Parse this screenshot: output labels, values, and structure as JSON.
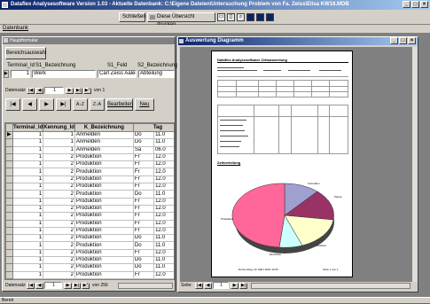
{
  "window": {
    "title": "Dataflex Analysesoftware Version 1.03 - Aktuelle Datenbank: C:\\Eigene Dateien\\Untersuchung Problem von Fa. Zeiss\\Elisa KW18.MDB"
  },
  "toolbar": {
    "close_label": "Schließen",
    "print_label": "Diese Übersicht drucken"
  },
  "menu": {
    "datenbank": "Datenbank"
  },
  "form": {
    "title": "Hauptformular",
    "bereichsauswahl_label": "Bereichsauswahl",
    "field_headers": [
      "Terminal_Id",
      "S1_Bezeichnung",
      "S1_Feld",
      "S2_Bezeichnung"
    ],
    "record_values": [
      "1",
      "Werk",
      "Carl Zeiss Aalen",
      "Abteilung"
    ],
    "datensatz_label": "Datensatz:",
    "datensatz_current": "1",
    "datensatz_total": "von 1",
    "bearbeiten_label": "Bearbeiten",
    "neu_label": "Neu"
  },
  "grid": {
    "columns": [
      "Terminal_Id",
      "Kennung_Id",
      "K_Bezeichnung",
      "Tag"
    ],
    "rows": [
      [
        "1",
        "1",
        "Anmelden",
        "Do",
        "11.0"
      ],
      [
        "1",
        "1",
        "Anmelden",
        "Do",
        "11.0"
      ],
      [
        "1",
        "1",
        "Anmelden",
        "Sa",
        "06.0"
      ],
      [
        "1",
        "2",
        "Produktion",
        "Fr",
        "12.0"
      ],
      [
        "1",
        "2",
        "Produktion",
        "Fr",
        "12.0"
      ],
      [
        "1",
        "2",
        "Produktion",
        "Fr",
        "12.0"
      ],
      [
        "1",
        "2",
        "Produktion",
        "Fr",
        "12.0"
      ],
      [
        "1",
        "2",
        "Produktion",
        "Fr",
        "12.0"
      ],
      [
        "1",
        "2",
        "Produktion",
        "Do",
        "11.0"
      ],
      [
        "1",
        "2",
        "Produktion",
        "Fr",
        "12.0"
      ],
      [
        "1",
        "2",
        "Produktion",
        "Fr",
        "12.0"
      ],
      [
        "1",
        "2",
        "Produktion",
        "Fr",
        "12.0"
      ],
      [
        "1",
        "2",
        "Produktion",
        "Fr",
        "12.0"
      ],
      [
        "1",
        "2",
        "Produktion",
        "Fr",
        "12.0"
      ],
      [
        "1",
        "2",
        "Produktion",
        "Do",
        "11.0"
      ],
      [
        "1",
        "2",
        "Produktion",
        "Do",
        "11.0"
      ],
      [
        "1",
        "2",
        "Produktion",
        "Fr",
        "12.0"
      ],
      [
        "1",
        "2",
        "Produktion",
        "Do",
        "11.0"
      ],
      [
        "1",
        "2",
        "Produktion",
        "Do",
        "11.0"
      ],
      [
        "1",
        "2",
        "Produktion",
        "Fr",
        "12.0"
      ]
    ],
    "nav_label": "Datensatz:",
    "nav_current": "1",
    "nav_total": "von 256"
  },
  "report": {
    "title": "Auswertung Diagramm",
    "page_heading": "Dataflex Analysesoftware Zeitauswertung",
    "section_title": "Zeitverteilung",
    "footer_left": "Donnerstag, 22. März 2001 10:33",
    "footer_right": "Seite 1 von 1",
    "seite_label": "Seite:",
    "seite_current": "1",
    "slices": [
      {
        "label": "Anmelden",
        "color": "#9f9fd0"
      },
      {
        "label": "Pause",
        "color": "#993366"
      },
      {
        "label": "Rüstzeit",
        "color": "#ffffcc"
      },
      {
        "label": "Einrichten",
        "color": "#ccffff"
      },
      {
        "label": "Produktion",
        "color": "#ff6699"
      }
    ]
  },
  "status": {
    "text": "Bereit"
  }
}
